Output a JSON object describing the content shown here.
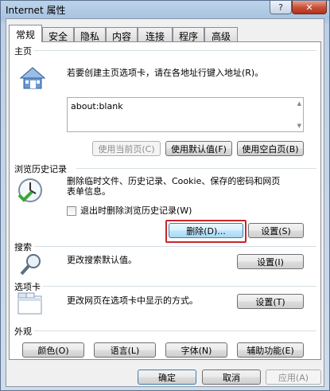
{
  "window": {
    "title": "Internet 属性",
    "help_glyph": "?",
    "close_glyph": "✕"
  },
  "tabs": [
    {
      "label": "常规",
      "active": true
    },
    {
      "label": "安全"
    },
    {
      "label": "隐私"
    },
    {
      "label": "内容"
    },
    {
      "label": "连接"
    },
    {
      "label": "程序"
    },
    {
      "label": "高级"
    }
  ],
  "homepage": {
    "group_label": "主页",
    "description": "若要创建主页选项卡，请在各地址行键入地址(R)。",
    "url_value": "about:blank",
    "buttons": {
      "use_current": "使用当前页(C)",
      "use_default": "使用默认值(F)",
      "use_blank": "使用空白页(B)"
    }
  },
  "history": {
    "group_label": "浏览历史记录",
    "description_line1": "删除临时文件、历史记录、Cookie、保存的密码和网页",
    "description_line2": "表单信息。",
    "checkbox_label": "退出时删除浏览历史记录(W)",
    "delete_label": "删除(D)...",
    "settings_label": "设置(S)"
  },
  "search": {
    "group_label": "搜索",
    "description": "更改搜索默认值。",
    "settings_label": "设置(I)"
  },
  "tabs_group": {
    "group_label": "选项卡",
    "description": "更改网页在选项卡中显示的方式。",
    "settings_label": "设置(T)"
  },
  "appearance": {
    "group_label": "外观",
    "buttons": {
      "colors": "颜色(O)",
      "languages": "语言(L)",
      "fonts": "字体(N)",
      "accessibility": "辅助功能(E)"
    }
  },
  "footer": {
    "ok": "确定",
    "cancel": "取消",
    "apply": "应用(A)"
  },
  "colors": {
    "highlight": "#c8262a",
    "focus_border": "#3c7fb1"
  }
}
